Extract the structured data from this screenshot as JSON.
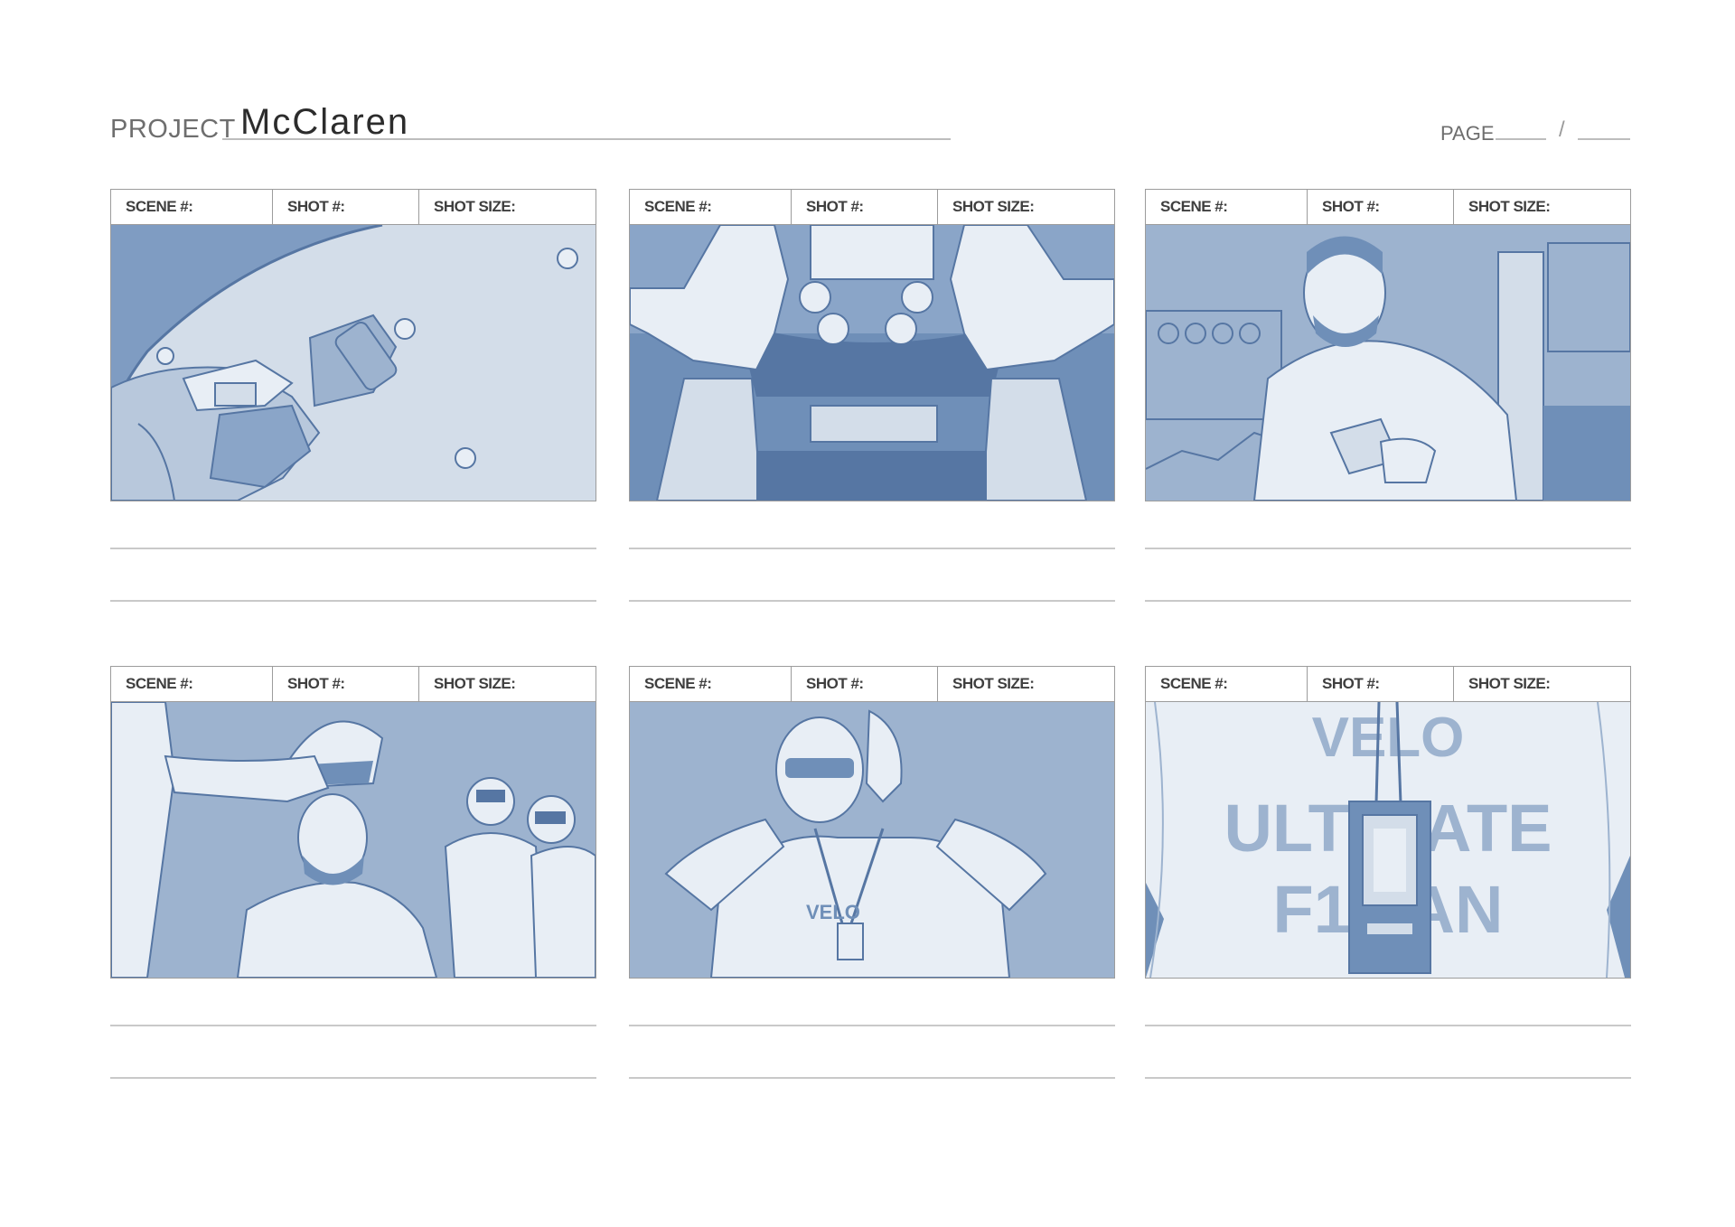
{
  "header": {
    "project_label": "PROJECT",
    "project_name": "McClaren",
    "page_label": "PAGE",
    "page_separator": "/"
  },
  "panel_labels": {
    "scene": "SCENE #:",
    "shot": "SHOT #:",
    "shot_size": "SHOT SIZE:"
  },
  "frame_text": {
    "velo": "VELO",
    "ultimate": "ULTIMATE",
    "f1": "F1 FAN",
    "chest": "VELO"
  },
  "colors": {
    "ink": "#5676a3",
    "dark_fill": "#6f8fb8",
    "mid_fill": "#9db3cf",
    "light_fill": "#d3dde9"
  }
}
